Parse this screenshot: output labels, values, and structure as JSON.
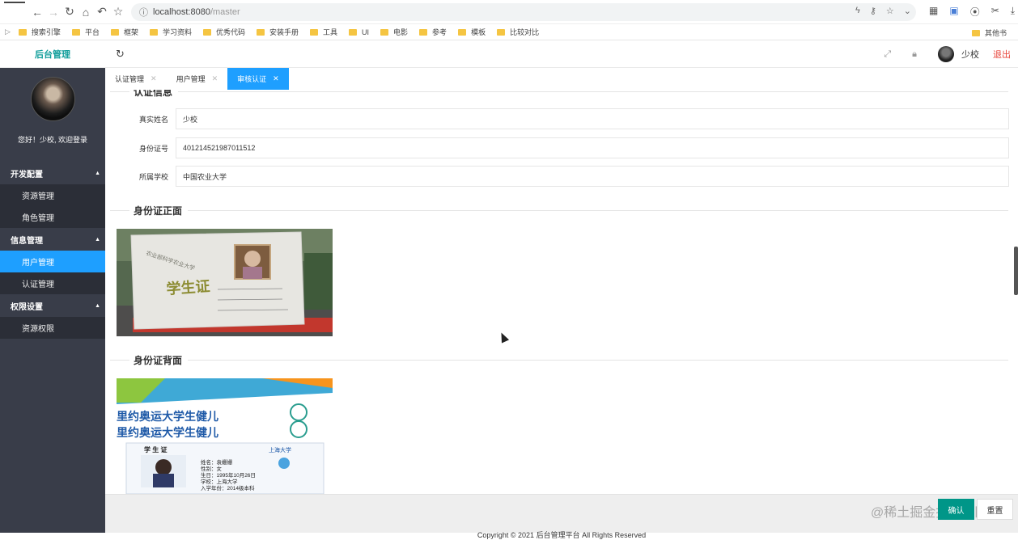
{
  "browser": {
    "url_host": "localhost:8080",
    "url_path": "/master",
    "bookmarks": [
      "搜索引擎",
      "平台",
      "框架",
      "学习资料",
      "优秀代码",
      "安装手册",
      "工具",
      "UI",
      "电影",
      "参考",
      "模板",
      "比较对比"
    ],
    "bookmark_other": "其他书"
  },
  "header": {
    "brand": "后台管理",
    "username": "少校",
    "logout": "退出"
  },
  "sidebar": {
    "welcome": "您好！少校, 欢迎登录",
    "groups": [
      {
        "label": "开发配置",
        "items": [
          {
            "label": "资源管理"
          },
          {
            "label": "角色管理"
          }
        ]
      },
      {
        "label": "信息管理",
        "items": [
          {
            "label": "用户管理"
          },
          {
            "label": "认证管理"
          }
        ]
      },
      {
        "label": "权限设置",
        "items": [
          {
            "label": "资源权限"
          }
        ]
      }
    ],
    "active_item": "用户管理"
  },
  "tabs": [
    {
      "label": "认证管理",
      "active": false
    },
    {
      "label": "用户管理",
      "active": false
    },
    {
      "label": "审核认证",
      "active": true
    }
  ],
  "form": {
    "section_info": "认证信息",
    "fields": [
      {
        "label": "真实姓名",
        "value": "少校"
      },
      {
        "label": "身份证号",
        "value": "401214521987011512"
      },
      {
        "label": "所属学校",
        "value": "中国农业大学"
      }
    ],
    "section_front": "身份证正面",
    "section_back": "身份证背面"
  },
  "front_image": {
    "card_title": "学生证",
    "header_text": "农业部科学农业大学"
  },
  "back_image": {
    "banner1": "里约奥运大学生健儿",
    "banner2": "里约奥运大学生健儿",
    "card_label": "学 生 证",
    "school": "上海大学",
    "lines": [
      "姓名：袁姗姗",
      "性别：女",
      "生日：1995年10月26日",
      "学校：上海大学",
      "入学年份：2014级本科"
    ]
  },
  "footer": {
    "copyright": "Copyright © 2021  后台管理平台  All Rights Reserved",
    "confirm": "确认",
    "reset": "重置",
    "watermark": "@稀土掘金技术社区"
  }
}
